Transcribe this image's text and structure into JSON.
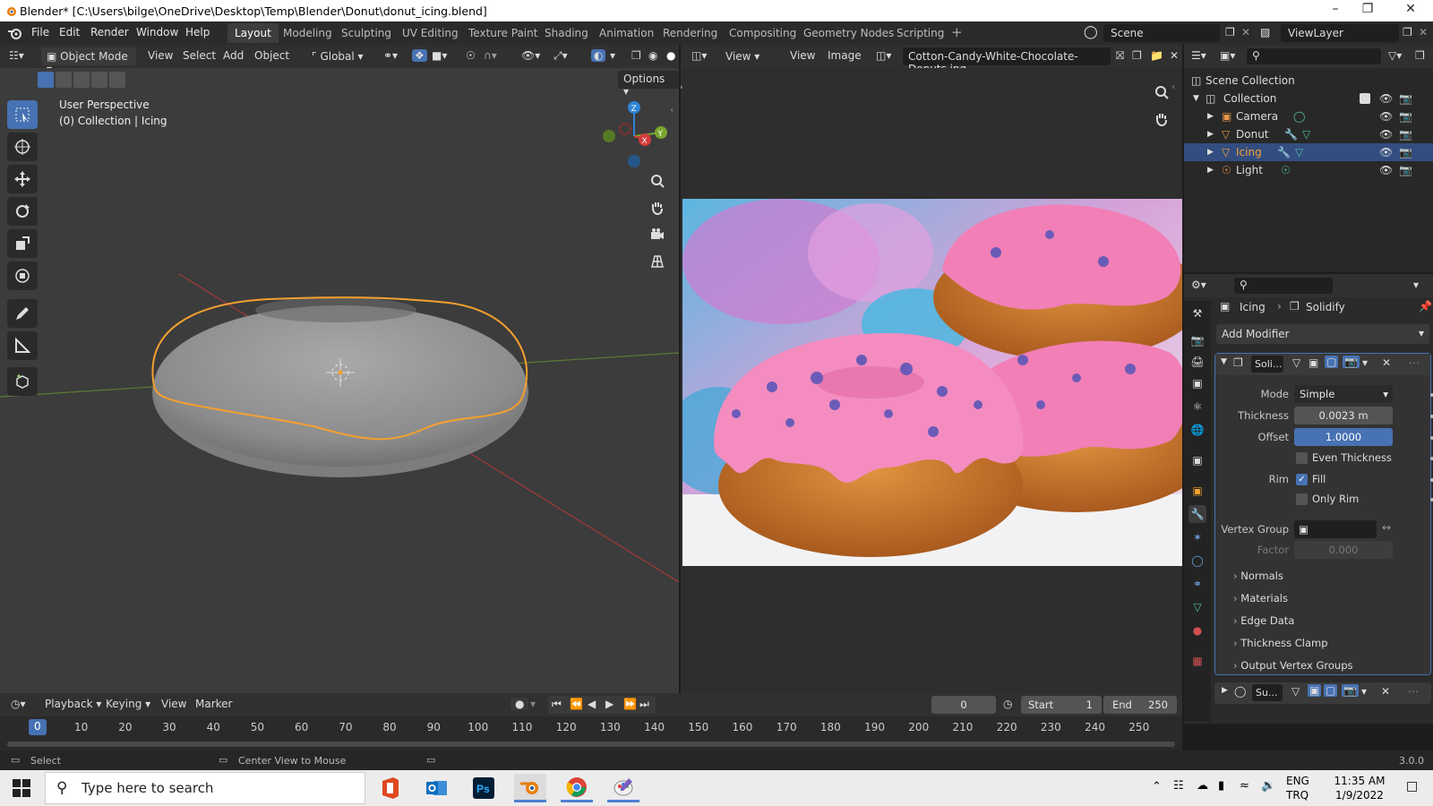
{
  "window": {
    "title": "Blender* [C:\\Users\\bilge\\OneDrive\\Desktop\\Temp\\Blender\\Donut\\donut_icing.blend]"
  },
  "menu": [
    "File",
    "Edit",
    "Render",
    "Window",
    "Help"
  ],
  "workspaces": [
    "Layout",
    "Modeling",
    "Sculpting",
    "UV Editing",
    "Texture Paint",
    "Shading",
    "Animation",
    "Rendering",
    "Compositing",
    "Geometry Nodes",
    "Scripting"
  ],
  "active_workspace": "Layout",
  "scene": "Scene",
  "view_layer": "ViewLayer",
  "viewport": {
    "mode": "Object Mode",
    "menus": [
      "View",
      "Select",
      "Add",
      "Object"
    ],
    "transform_orientation": "Global",
    "options_label": "Options",
    "perspective_label": "User Perspective",
    "collection_label": "(0) Collection | Icing",
    "gizmo_labels": {
      "z": "Z",
      "y": "Y",
      "x": "X"
    }
  },
  "image_editor": {
    "view_label": "View",
    "menus": [
      "View",
      "Image"
    ],
    "image_name": "Cotton-Candy-White-Chocolate-Donuts.jpg"
  },
  "outliner": {
    "scene_collection": "Scene Collection",
    "collection": "Collection",
    "items": [
      {
        "name": "Camera",
        "selected": false
      },
      {
        "name": "Donut",
        "selected": false
      },
      {
        "name": "Icing",
        "selected": true
      },
      {
        "name": "Light",
        "selected": false
      }
    ]
  },
  "properties": {
    "object_name": "Icing",
    "modifier_name": "Solidify",
    "add_modifier_label": "Add Modifier",
    "modifier_short": "Soli...",
    "mode_label": "Mode",
    "mode_value": "Simple",
    "thickness_label": "Thickness",
    "thickness_value": "0.0023 m",
    "offset_label": "Offset",
    "offset_value": "1.0000",
    "offset_fill_fraction": 1.0,
    "even_thickness_label": "Even Thickness",
    "even_thickness_checked": false,
    "rim_label": "Rim",
    "fill_label": "Fill",
    "fill_checked": true,
    "only_rim_label": "Only Rim",
    "only_rim_checked": false,
    "vertex_group_label": "Vertex Group",
    "factor_label": "Factor",
    "factor_value": "0.000",
    "subpanels": [
      "Normals",
      "Materials",
      "Edge Data",
      "Thickness Clamp",
      "Output Vertex Groups"
    ],
    "second_modifier_short": "Su..."
  },
  "timeline": {
    "menus": [
      "Playback",
      "Keying",
      "View",
      "Marker"
    ],
    "current_frame": "0",
    "start_label": "Start",
    "start_value": "1",
    "end_label": "End",
    "end_value": "250",
    "frame_marker": "0",
    "frame_labels": [
      "10",
      "20",
      "30",
      "40",
      "50",
      "60",
      "70",
      "80",
      "90",
      "100",
      "110",
      "120",
      "130",
      "140",
      "150",
      "160",
      "170",
      "180",
      "190",
      "200",
      "210",
      "220",
      "230",
      "240",
      "250"
    ]
  },
  "statusbar": {
    "select_label": "Select",
    "center_view_label": "Center View to Mouse",
    "version": "3.0.0"
  },
  "taskbar": {
    "search_placeholder": "Type here to search",
    "lang_top": "ENG",
    "lang_bottom": "TRQ",
    "time": "11:35 AM",
    "date": "1/9/2022"
  },
  "colors": {
    "accent_blue": "#4772b3",
    "selection_orange": "#f5a030",
    "outliner_selected": "#334d80"
  }
}
